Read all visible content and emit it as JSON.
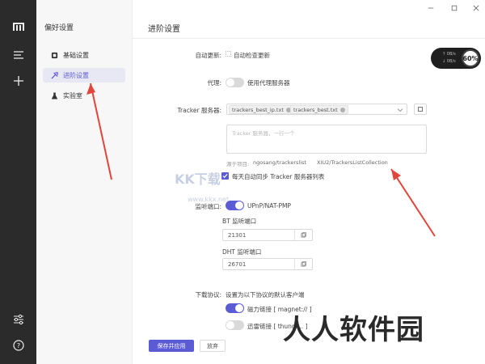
{
  "window": {
    "minimize_icon": "minimize-icon",
    "restore_icon": "restore-icon",
    "close_icon": "close-icon"
  },
  "rail": {
    "items": [
      {
        "icon": "logo-icon"
      },
      {
        "icon": "menu-icon"
      },
      {
        "icon": "add-icon"
      },
      {
        "icon": "sliders-icon"
      },
      {
        "icon": "help-icon"
      }
    ]
  },
  "sidebar": {
    "title": "偏好设置",
    "items": [
      {
        "label": "基础设置",
        "icon": "basic-settings-icon"
      },
      {
        "label": "进阶设置",
        "icon": "advanced-settings-icon",
        "active": true
      },
      {
        "label": "实验室",
        "icon": "lab-icon"
      }
    ]
  },
  "main": {
    "title": "进阶设置",
    "auto_update": {
      "label": "自动更新:",
      "option": "自动检查更新"
    },
    "proxy": {
      "label": "代理:",
      "option": "使用代理服务器",
      "enabled": false
    },
    "tracker": {
      "label": "Tracker 服务器:",
      "tags": [
        "trackers_best_ip.txt",
        "trackers_best.txt"
      ],
      "textarea_placeholder": "Tracker 服务器，一行一个",
      "source_prefix": "源于项目:",
      "source_1": "ngosang/trackerslist",
      "source_2": "XIU2/TrackersListCollection",
      "auto_sync": "每天自动同步 Tracker 服务器列表",
      "auto_sync_checked": true
    },
    "listen_port": {
      "label": "监听端口:",
      "upnp": "UPnP/NAT-PMP",
      "upnp_enabled": true,
      "bt_label": "BT 监听端口",
      "bt_value": "21301",
      "dht_label": "DHT 监听端口",
      "dht_value": "26701"
    },
    "download_protocol": {
      "label": "下载协议:",
      "desc": "设置为以下协议的默认客户端",
      "magnet": "磁力链接 [ magnet:// ]",
      "magnet_enabled": true,
      "thunder": "迅雷链接 [ thund ... ]",
      "thunder_enabled": false
    },
    "save_button": "保存并应用",
    "discard_button": "放弃"
  },
  "speed_widget": {
    "upload": "0B/s",
    "download": "0B/s",
    "percent": "60%"
  },
  "watermarks": {
    "center": "KK下载",
    "center_sub": "www.kkx.net",
    "corner": "人人软件园"
  },
  "colors": {
    "accent": "#5b5bd6",
    "rail": "#2b2b2b",
    "annotation_arrow": "#e0463c"
  }
}
